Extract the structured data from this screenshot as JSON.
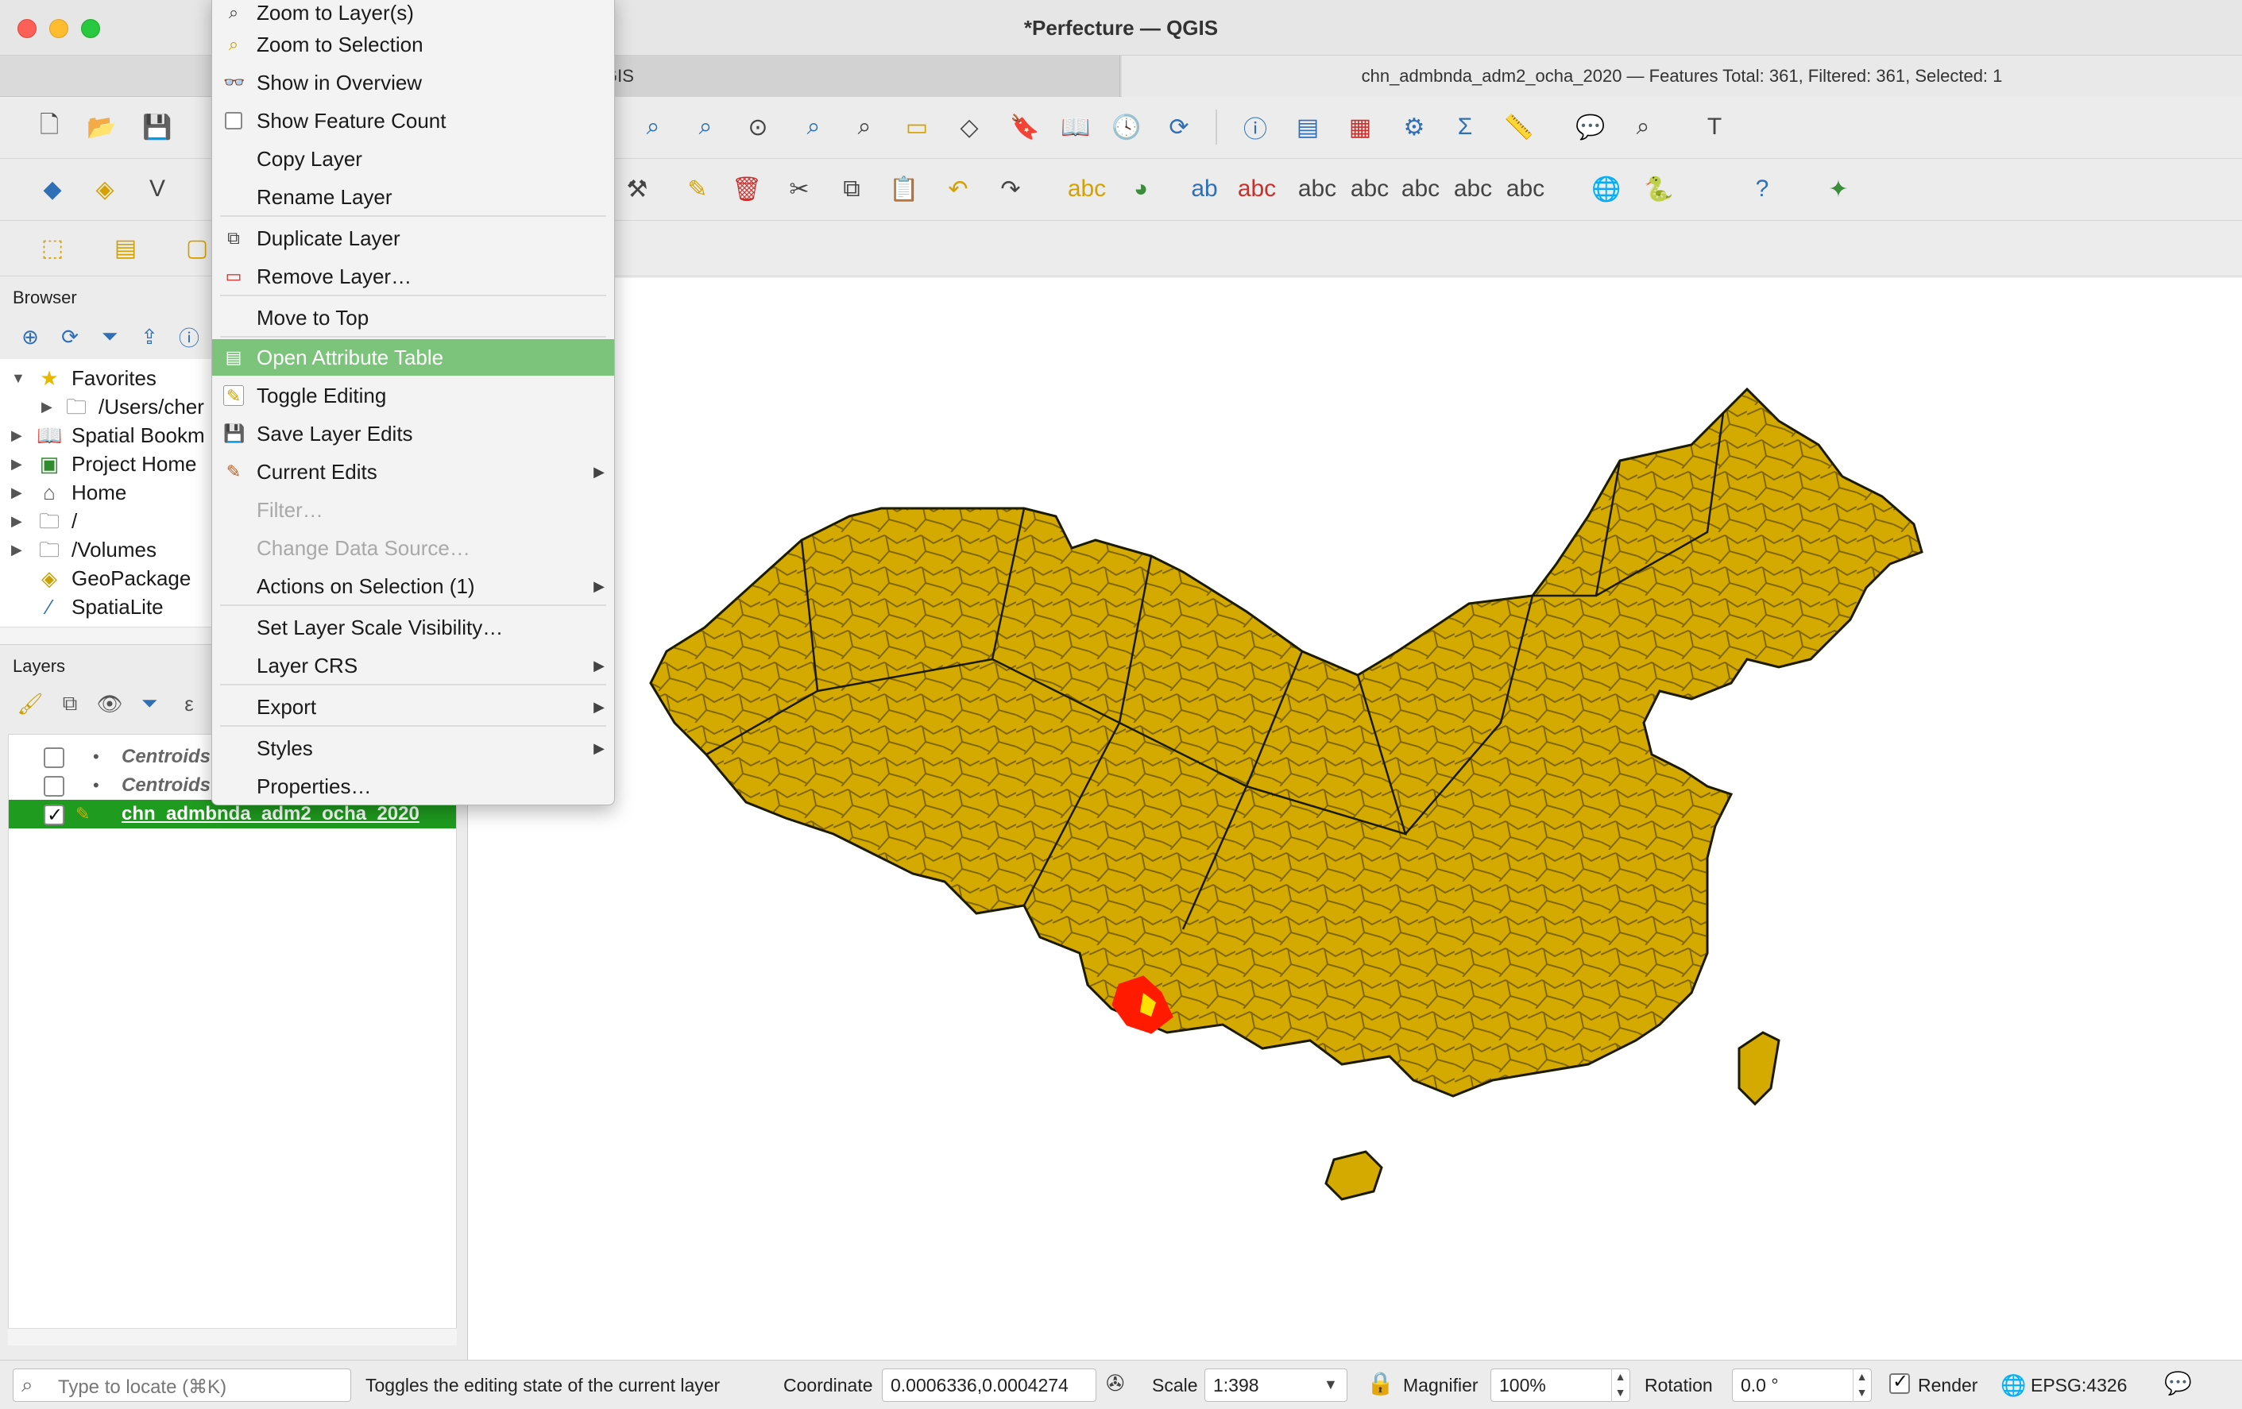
{
  "window": {
    "title": "*Perfecture — QGIS"
  },
  "tabs": [
    {
      "label": "GIS"
    },
    {
      "label": "chn_admbnda_adm2_ocha_2020 — Features Total: 361, Filtered: 361, Selected: 1"
    }
  ],
  "browser": {
    "title": "Browser",
    "items": [
      {
        "label": "Favorites",
        "icon": "star-icon"
      },
      {
        "label": "/Users/cher",
        "icon": "folder-icon"
      },
      {
        "label": "Spatial Bookm",
        "icon": "bookmark-icon"
      },
      {
        "label": "Project Home",
        "icon": "project-home-icon"
      },
      {
        "label": "Home",
        "icon": "home-icon"
      },
      {
        "label": "/",
        "icon": "folder-icon"
      },
      {
        "label": "/Volumes",
        "icon": "folder-icon"
      },
      {
        "label": "GeoPackage",
        "icon": "geopackage-icon"
      },
      {
        "label": "SpatiaLite",
        "icon": "spatialite-icon"
      }
    ]
  },
  "layers": {
    "title": "Layers",
    "items": [
      {
        "label": "Centroids",
        "checked": false
      },
      {
        "label": "Centroids",
        "checked": false
      },
      {
        "label": "chn_admbnda_adm2_ocha_2020",
        "checked": true
      }
    ]
  },
  "context_menu": {
    "items": [
      {
        "label": "Zoom to Layer(s)",
        "icon": "zoom-layer-icon"
      },
      {
        "label": "Zoom to Selection",
        "icon": "zoom-selection-icon"
      },
      {
        "label": "Show in Overview",
        "icon": "overview-icon"
      },
      {
        "label": "Show Feature Count",
        "icon": "checkbox-icon"
      },
      {
        "label": "Copy Layer",
        "icon": ""
      },
      {
        "label": "Rename Layer",
        "icon": ""
      },
      {
        "label": "Duplicate Layer",
        "icon": "duplicate-icon"
      },
      {
        "label": "Remove Layer…",
        "icon": "remove-layer-icon"
      },
      {
        "label": "Move to Top",
        "icon": ""
      },
      {
        "label": "Open Attribute Table",
        "icon": "attribute-table-icon"
      },
      {
        "label": "Toggle Editing",
        "icon": "pencil-icon"
      },
      {
        "label": "Save Layer Edits",
        "icon": "save-edits-icon"
      },
      {
        "label": "Current Edits",
        "icon": "current-edits-icon"
      },
      {
        "label": "Filter…",
        "icon": ""
      },
      {
        "label": "Change Data Source…",
        "icon": ""
      },
      {
        "label": "Actions on Selection (1)",
        "icon": ""
      },
      {
        "label": "Set Layer Scale Visibility…",
        "icon": ""
      },
      {
        "label": "Layer CRS",
        "icon": ""
      },
      {
        "label": "Export",
        "icon": ""
      },
      {
        "label": "Styles",
        "icon": ""
      },
      {
        "label": "Properties…",
        "icon": ""
      }
    ]
  },
  "status": {
    "locator_placeholder": "Type to locate (⌘K)",
    "message": "Toggles the editing state of the current layer",
    "coordinate_label": "Coordinate",
    "coordinate_value": "0.0006336,0.0004274",
    "scale_label": "Scale",
    "scale_value": "1:398",
    "magnifier_label": "Magnifier",
    "magnifier_value": "100%",
    "rotation_label": "Rotation",
    "rotation_value": "0.0 °",
    "render_label": "Render",
    "crs": "EPSG:4326"
  },
  "colors": {
    "map_fill": "#d4aa00",
    "selection": "#ff1a00",
    "highlight": "#7cc47c",
    "active_layer": "#1f9c1f"
  }
}
